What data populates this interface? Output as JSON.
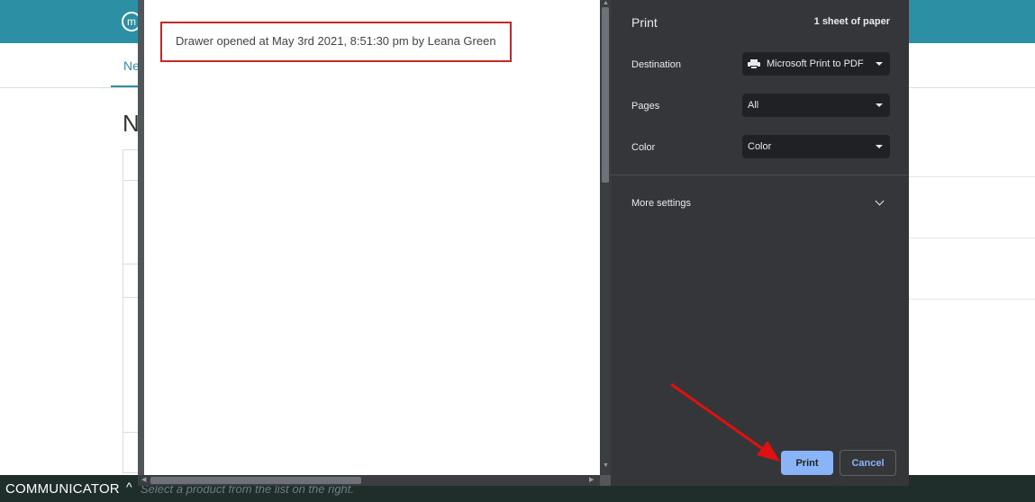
{
  "app": {
    "logo_glyph": "m",
    "nav_tab_label": "Ne",
    "page_title": "N"
  },
  "bottom_bar": {
    "title": "COMMUNICATOR",
    "caret": "^",
    "hint": "Select a product from the list on the right."
  },
  "preview": {
    "drawer_text": "Drawer opened at May 3rd 2021, 8:51:30 pm by Leana Green"
  },
  "print_settings": {
    "title": "Print",
    "sheets": "1 sheet of paper",
    "destination": {
      "label": "Destination",
      "value": "Microsoft Print to PDF",
      "icon": "printer-icon"
    },
    "pages": {
      "label": "Pages",
      "value": "All"
    },
    "color": {
      "label": "Color",
      "value": "Color"
    },
    "more_settings": "More settings",
    "print_button": "Print",
    "cancel_button": "Cancel"
  },
  "colors": {
    "app_header": "#2d8fa4",
    "dialog_bg": "#35363a",
    "print_button_bg": "#8ab4f8",
    "annotation_red": "#e01010"
  }
}
